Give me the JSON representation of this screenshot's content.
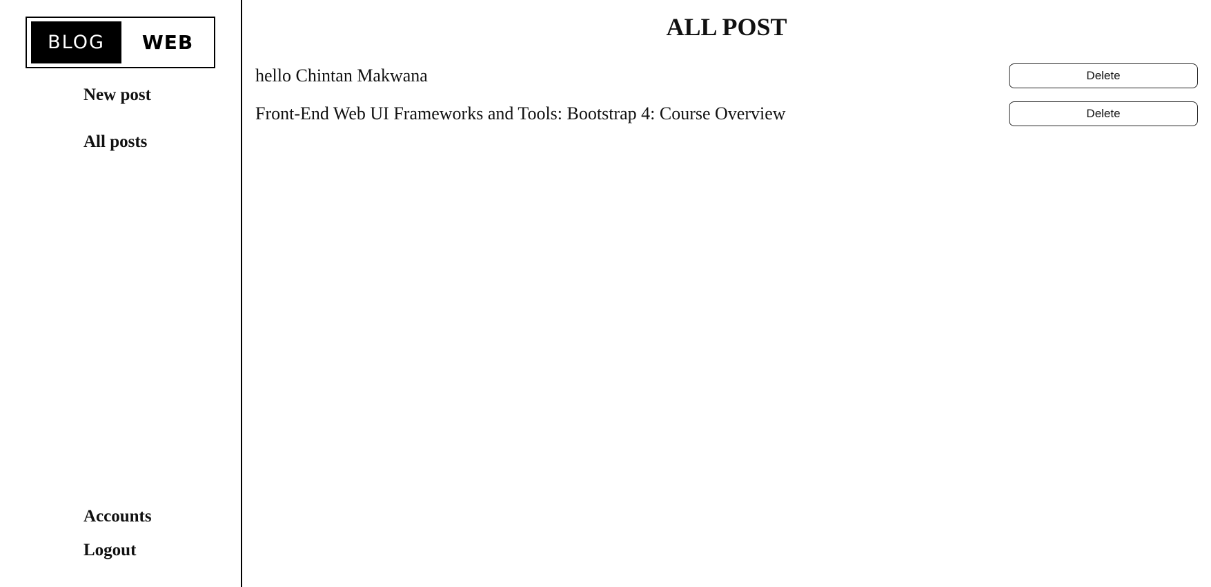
{
  "sidebar": {
    "logo": {
      "left_text": "BLOG",
      "right_text": "WEB"
    },
    "nav": {
      "new_post": "New post",
      "all_posts": "All posts",
      "accounts": "Accounts",
      "logout": "Logout"
    }
  },
  "main": {
    "title": "ALL POST",
    "posts": [
      {
        "title": "hello Chintan Makwana",
        "action": "Delete"
      },
      {
        "title": "Front-End Web UI Frameworks and Tools: Bootstrap 4: Course Overview",
        "action": "Delete"
      }
    ]
  },
  "colors": {
    "background": "#ffffff",
    "text": "#111111",
    "logo_block": "#000000",
    "border": "#000000"
  }
}
